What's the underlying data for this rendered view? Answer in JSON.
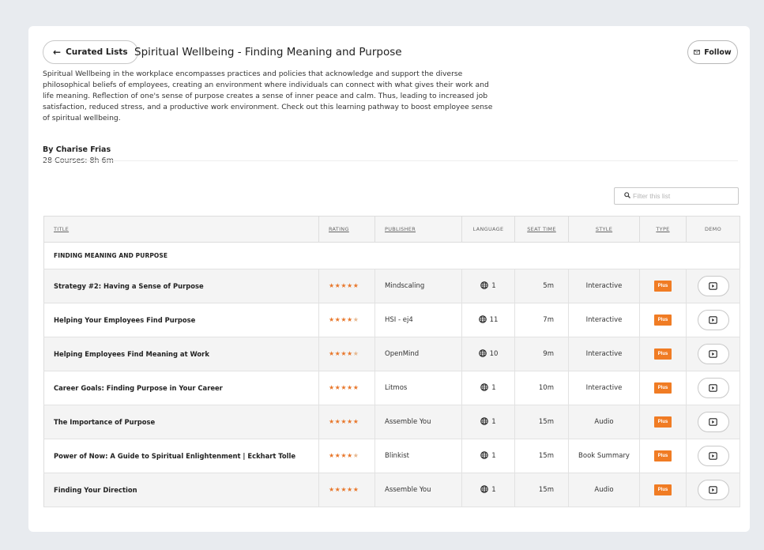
{
  "header": {
    "back_label": "Curated Lists",
    "title": "Spiritual Wellbeing - Finding Meaning and Purpose",
    "follow_label": "Follow",
    "description": "Spiritual Wellbeing in the workplace encompasses practices and policies that acknowledge and support the diverse philosophical beliefs of employees, creating an environment where individuals can connect with what gives their work and life meaning. Reflection of one's sense of purpose creates a sense of inner peace and calm. Thus, leading to increased job satisfaction, reduced stress, and a productive work environment. Check out this learning pathway to boost employee sense of spiritual wellbeing.",
    "author": "By Charise Frias",
    "meta": "28 Courses: 8h 6m"
  },
  "filter": {
    "placeholder": "Filter this list"
  },
  "table": {
    "columns": {
      "title": "Title",
      "rating": "Rating",
      "publisher": "Publisher",
      "language": "Language",
      "seat_time": "Seat Time",
      "style": "Style",
      "type": "Type",
      "demo": "Demo"
    },
    "group": "FINDING MEANING AND PURPOSE",
    "rows": [
      {
        "title": "Strategy #2: Having a Sense of Purpose",
        "rating": 5,
        "stars": "★★★★★",
        "publisher": "Mindscaling",
        "language": "1",
        "seat_time": "5m",
        "style": "Interactive",
        "type": "Plus"
      },
      {
        "title": "Helping Your Employees Find Purpose",
        "rating": 4.5,
        "stars": "★★★★★",
        "publisher": "HSI - ej4",
        "language": "11",
        "seat_time": "7m",
        "style": "Interactive",
        "type": "Plus"
      },
      {
        "title": "Helping Employees Find Meaning at Work",
        "rating": 4.5,
        "stars": "★★★★★",
        "publisher": "OpenMind",
        "language": "10",
        "seat_time": "9m",
        "style": "Interactive",
        "type": "Plus"
      },
      {
        "title": "Career Goals: Finding Purpose in Your Career",
        "rating": 5,
        "stars": "★★★★★",
        "publisher": "Litmos",
        "language": "1",
        "seat_time": "10m",
        "style": "Interactive",
        "type": "Plus"
      },
      {
        "title": "The Importance of Purpose",
        "rating": 5,
        "stars": "★★★★★",
        "publisher": "Assemble You",
        "language": "1",
        "seat_time": "15m",
        "style": "Audio",
        "type": "Plus"
      },
      {
        "title": "Power of Now: A Guide to Spiritual Enlightenment | Eckhart Tolle",
        "rating": 4,
        "stars": "★★★★★",
        "publisher": "Blinkist",
        "language": "1",
        "seat_time": "15m",
        "style": "Book Summary",
        "type": "Plus"
      },
      {
        "title": "Finding Your Direction",
        "rating": 5,
        "stars": "★★★★★",
        "publisher": "Assemble You",
        "language": "1",
        "seat_time": "15m",
        "style": "Audio",
        "type": "Plus"
      }
    ]
  },
  "colors": {
    "accent": "#f07c24",
    "background": "#e8ebef",
    "row_alt": "#f4f4f4"
  },
  "icons": {
    "back": "arrow-left-icon",
    "follow": "mail-icon",
    "filter": "search-icon",
    "language": "globe-icon",
    "demo": "play-screen-icon"
  }
}
